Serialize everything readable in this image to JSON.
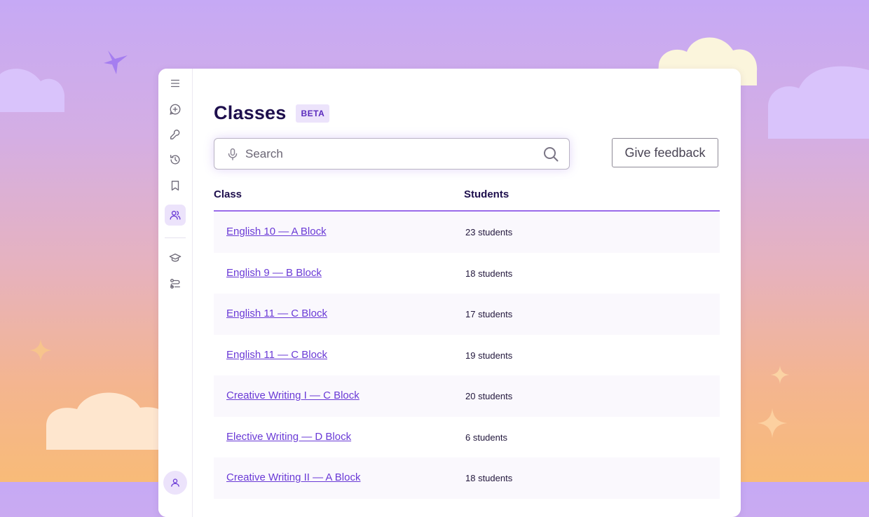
{
  "sidebar": {
    "items": [
      {
        "name": "menu-icon"
      },
      {
        "name": "add-circle-icon"
      },
      {
        "name": "wrench-icon"
      },
      {
        "name": "history-icon"
      },
      {
        "name": "bookmark-icon"
      },
      {
        "name": "users-icon",
        "active": true
      },
      {
        "name": "graduation-cap-icon"
      },
      {
        "name": "workflow-icon"
      }
    ]
  },
  "header": {
    "title": "Classes",
    "badge": "BETA"
  },
  "search": {
    "placeholder": "Search"
  },
  "feedback": {
    "label": "Give feedback"
  },
  "table": {
    "columns": [
      "Class",
      "Students"
    ],
    "rows": [
      {
        "class": "English 10  — A Block",
        "students": "23 students"
      },
      {
        "class": "English 9  — B Block",
        "students": "18 students"
      },
      {
        "class": "English 11  — C Block",
        "students": "17 students"
      },
      {
        "class": "English 11  — C Block",
        "students": "19 students"
      },
      {
        "class": "Creative Writing I  — C Block",
        "students": "20 students"
      },
      {
        "class": "Elective Writing  — D Block",
        "students": "6 students"
      },
      {
        "class": "Creative Writing II  — A Block",
        "students": "18 students"
      }
    ]
  },
  "colors": {
    "accent": "#6a3ad6",
    "title": "#1e0f4d",
    "badge_bg": "#ece3fb"
  }
}
